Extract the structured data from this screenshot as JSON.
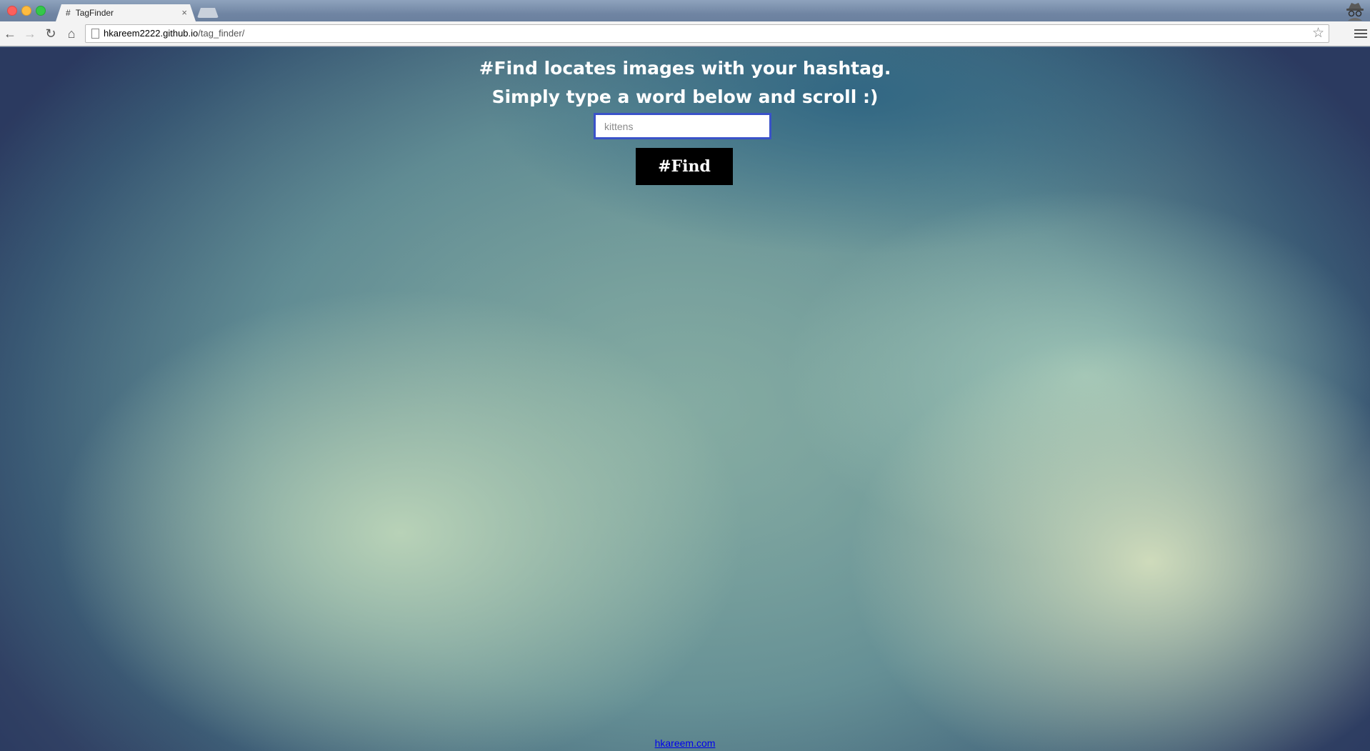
{
  "browser": {
    "tab": {
      "favicon": "#",
      "title": "TagFinder",
      "close": "×"
    },
    "toolbar": {
      "back_icon": "←",
      "forward_icon": "→",
      "reload_icon": "↻",
      "home_icon": "⌂",
      "star_icon": "☆"
    },
    "address_bar": {
      "host": "hkareem2222.github.io",
      "path": "/tag_finder/"
    }
  },
  "page": {
    "headline_line1": "#Find locates images with your hashtag.",
    "headline_line2": "Simply type a word below and scroll :)",
    "search": {
      "value": "",
      "placeholder": "kittens"
    },
    "find_button_label": "#Find",
    "footer_link": "hkareem.com"
  },
  "colors": {
    "input_border": "#3a52c9",
    "button_bg": "#000000",
    "link": "#0000ee"
  }
}
